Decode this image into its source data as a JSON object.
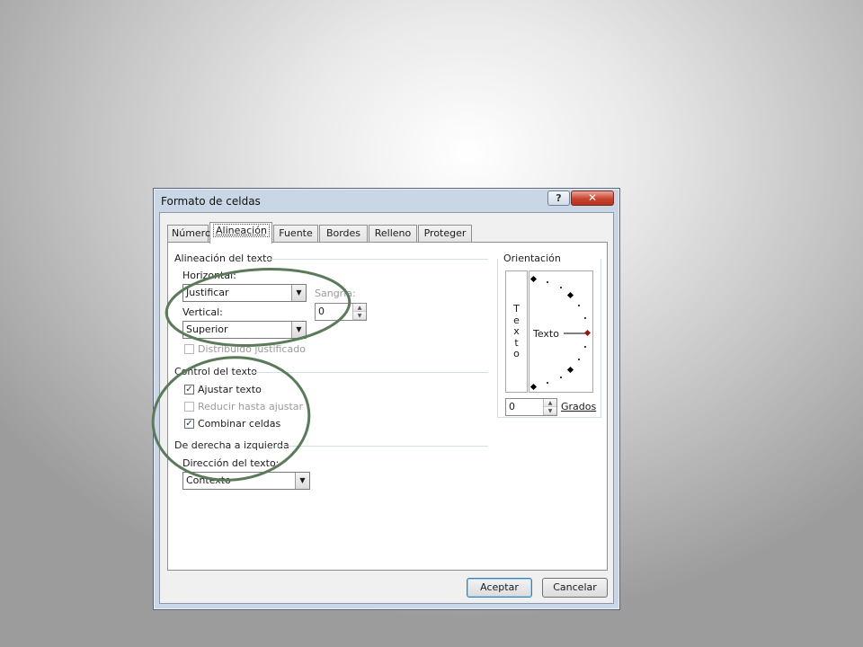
{
  "dialog": {
    "title": "Formato de celdas",
    "help_glyph": "?",
    "close_glyph": "✕"
  },
  "tabs": [
    {
      "label": "Número"
    },
    {
      "label": "Alineación"
    },
    {
      "label": "Fuente"
    },
    {
      "label": "Bordes"
    },
    {
      "label": "Relleno"
    },
    {
      "label": "Proteger"
    }
  ],
  "alignment": {
    "section_label": "Alineación del texto",
    "horizontal_label": "Horizontal:",
    "horizontal_value": "Justificar",
    "vertical_label": "Vertical:",
    "vertical_value": "Superior",
    "indent_label": "Sangría:",
    "indent_value": "0",
    "distributed_label": "Distribuido justificado"
  },
  "text_control": {
    "section_label": "Control del texto",
    "wrap_label": "Ajustar texto",
    "wrap_checked": true,
    "shrink_label": "Reducir hasta ajustar",
    "shrink_checked": false,
    "merge_label": "Combinar celdas",
    "merge_checked": true
  },
  "rtl": {
    "section_label": "De derecha a izquierda",
    "direction_label": "Dirección del texto:",
    "direction_value": "Contexto"
  },
  "orientation": {
    "section_label": "Orientación",
    "vertical_text_letters": [
      "T",
      "e",
      "x",
      "t",
      "o"
    ],
    "dial_text": "Texto",
    "degrees_value": "0",
    "degrees_label": "Grados"
  },
  "buttons": {
    "ok_label": "Aceptar",
    "cancel_label": "Cancelar"
  },
  "colors": {
    "annotation_circle": "#5a7a5a",
    "orientation_marker": "#8b1a1a"
  }
}
